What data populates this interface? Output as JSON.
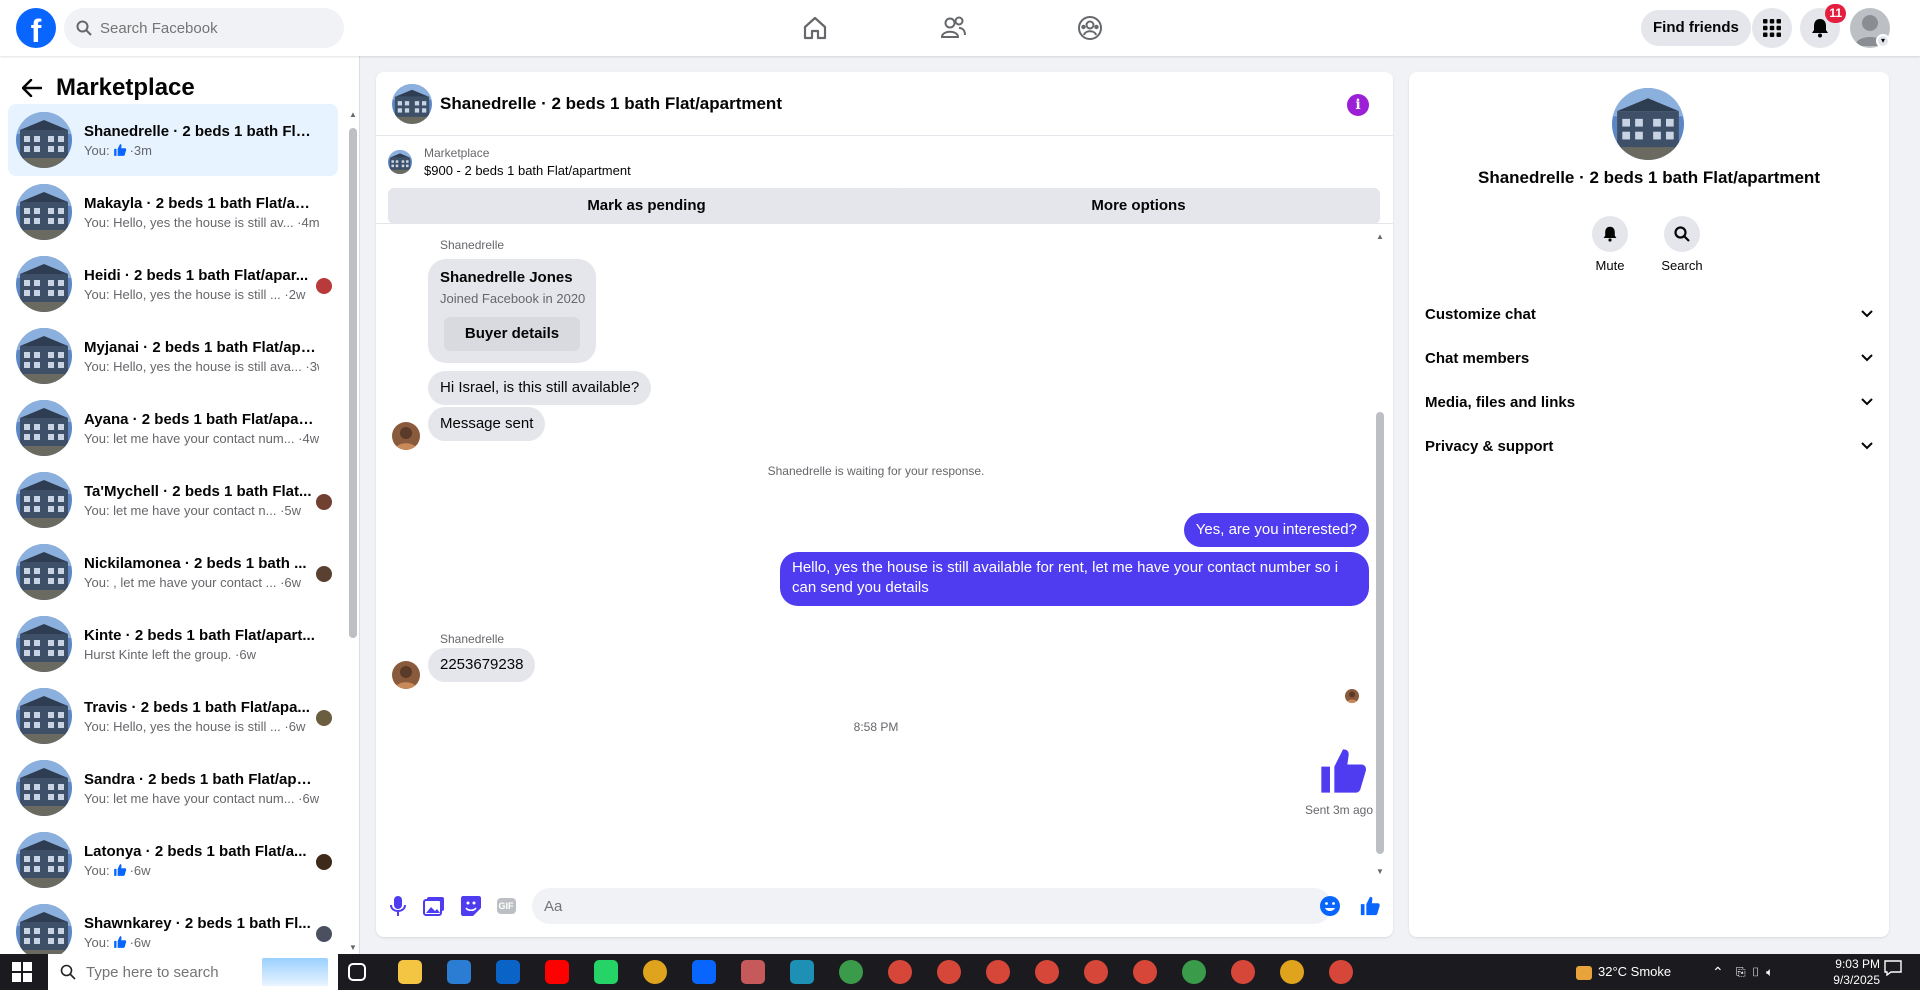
{
  "search": {
    "placeholder": "Search Facebook"
  },
  "header": {
    "find_friends": "Find friends",
    "notifications_count": "11",
    "brand_color": "#0866ff"
  },
  "sidebar": {
    "title": "Marketplace",
    "conversations": [
      {
        "name": "Shanedrelle · 2 beds 1 bath Flat/...",
        "preview": "You:",
        "liked": true,
        "time": "3m",
        "active": true
      },
      {
        "name": "Makayla · 2 beds 1 bath Flat/apa...",
        "preview": "You: Hello, yes the house is still av... ·",
        "time": "4m"
      },
      {
        "name": "Heidi · 2 beds 1 bath Flat/apar...",
        "preview": "You: Hello, yes the house is still ... ·",
        "time": "2w"
      },
      {
        "name": "Myjanai · 2 beds 1 bath Flat/apa...",
        "preview": "You: Hello, yes the house is still ava... ·",
        "time": "3w"
      },
      {
        "name": "Ayana · 2 beds 1 bath Flat/apart...",
        "preview": "You: let me have your contact num... ·",
        "time": "4w"
      },
      {
        "name": "Ta'Mychell · 2 beds 1 bath Flat...",
        "preview": "You: let me have your contact n... ·",
        "time": "5w"
      },
      {
        "name": "Nickilamonea · 2 beds 1 bath ...",
        "preview": "You: , let me have your contact ... ·",
        "time": "6w"
      },
      {
        "name": "Kinte · 2 beds 1 bath Flat/apart...",
        "preview": "Hurst Kinte left the group. ·",
        "time": "6w"
      },
      {
        "name": "Travis · 2 beds 1 bath Flat/apa...",
        "preview": "You: Hello, yes the house is still ... ·",
        "time": "6w"
      },
      {
        "name": "Sandra · 2 beds 1 bath Flat/apart...",
        "preview": "You: let me have your contact num... ·",
        "time": "6w"
      },
      {
        "name": "Latonya · 2 beds 1 bath Flat/a...",
        "preview": "You:",
        "liked": true,
        "time": "6w"
      },
      {
        "name": "Shawnkarey · 2 beds 1 bath Fl...",
        "preview": "You:",
        "liked": true,
        "time": "6w"
      }
    ]
  },
  "chat": {
    "title": "Shanedrelle · 2 beds 1 bath Flat/apartment",
    "listing_source": "Marketplace",
    "listing_price": "$900 - 2 beds 1 bath Flat/apartment",
    "mark_pending": "Mark as pending",
    "more_options": "More options",
    "sender_label": "Shanedrelle",
    "buyer_name": "Shanedrelle Jones",
    "buyer_joined": "Joined Facebook in 2020",
    "buyer_details": "Buyer details",
    "msg1": "Hi Israel, is this still available?",
    "msg2": "Message sent",
    "waiting": "Shanedrelle is waiting for your response.",
    "out1": "Yes, are you interested?",
    "out2": "Hello, yes the house is still available for rent, let me have your contact number so i can send you details",
    "sender_label2": "Shanedrelle",
    "msg3": "2253679238",
    "timestamp": "8:58 PM",
    "sent_status": "Sent 3m ago",
    "composer_placeholder": "Aa",
    "gif_label": "GIF",
    "accent_color": "#4f3cf0"
  },
  "rpanel": {
    "title": "Shanedrelle · 2 beds 1 bath Flat/apartment",
    "mute": "Mute",
    "search": "Search",
    "rows": [
      "Customize chat",
      "Chat members",
      "Media, files and links",
      "Privacy & support"
    ]
  },
  "taskbar": {
    "search_placeholder": "Type here to search",
    "weather": "32°C  Smoke",
    "time": "9:03 PM",
    "date": "9/3/2025"
  }
}
